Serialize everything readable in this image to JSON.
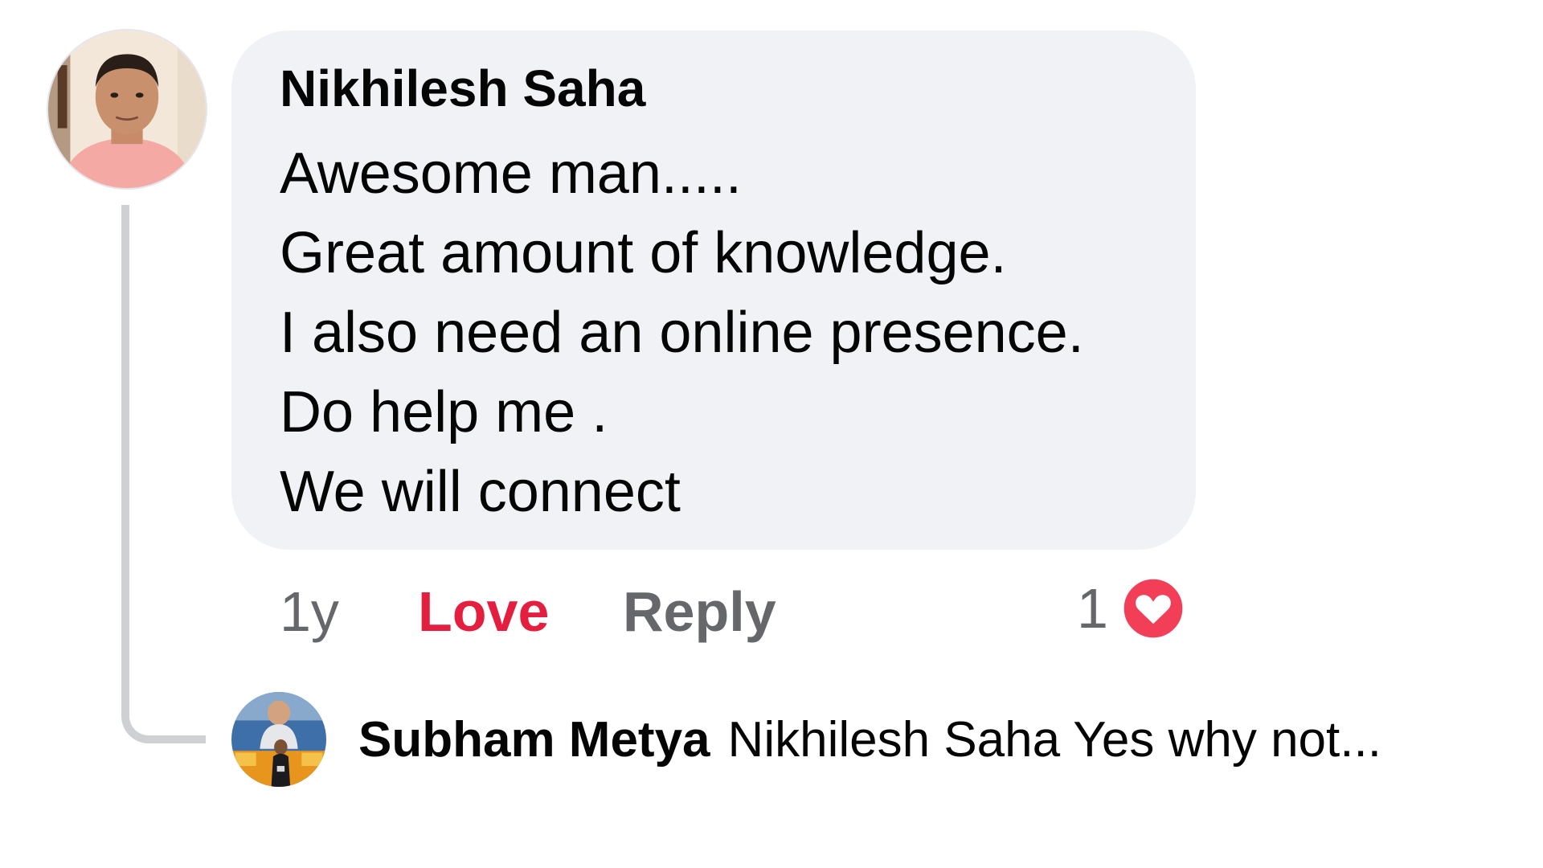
{
  "comment": {
    "author": "Nikhilesh Saha",
    "lines": [
      "Awesome man.....",
      "Great amount of knowledge.",
      "I also need an online presence.",
      "Do help me .",
      "We will connect"
    ],
    "time": "1y",
    "love_label": "Love",
    "reply_label": "Reply",
    "reaction_count": "1",
    "reaction_icon": "heart-icon",
    "avatar_icon": "avatar-photo"
  },
  "reply": {
    "author": "Subham Metya",
    "text": "Nikhilesh Saha Yes why not...",
    "avatar_icon": "avatar-photo"
  },
  "colors": {
    "bubble_bg": "#f0f2f5",
    "text": "#050505",
    "secondary_text": "#65676b",
    "love_red": "#e41e3f",
    "thread_line": "#ced0d4"
  }
}
